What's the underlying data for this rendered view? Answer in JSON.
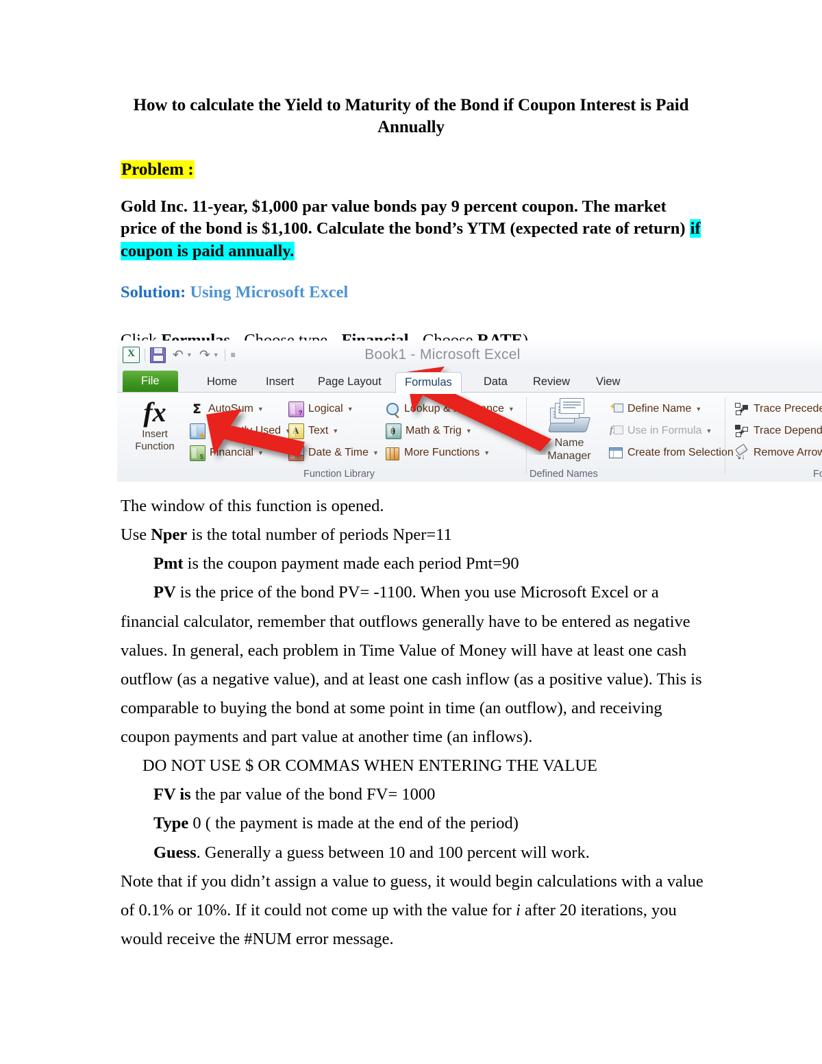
{
  "document": {
    "title_line1": "How to calculate the Yield to Maturity of the Bond if Coupon Interest is Paid",
    "title_line2": "Annually",
    "problem_label": "Problem :",
    "problem_text_part1": "Gold Inc. 11-year, $1,000 par value bonds pay 9 percent coupon. The market price of the bond is $1,100. Calculate the bond’s YTM (expected rate of return)",
    "problem_text_highlight": "if coupon is paid annually.",
    "solution_label": "Solution:",
    "solution_rest": "Using Microsoft Excel",
    "click_instruction": {
      "prefix": "Click ",
      "bold1": "Formulas - ",
      "mid1": " Choose type - ",
      "bold2": " Financial - ",
      "mid2": " Choose ",
      "bold3": "RATE",
      "suffix": ")"
    },
    "paragraphs": {
      "window_opened": "The window of this function is opened.",
      "nper_prefix": "Use  ",
      "nper_bold": "Nper",
      "nper_rest": " is the total number of periods Nper=11",
      "pmt_bold": "Pmt",
      "pmt_rest": " is the coupon payment made each period Pmt=90",
      "pv_bold": "PV",
      "pv_rest": " is the price of the bond PV= -1100.   When you use Microsoft Excel or a",
      "long_para": "financial calculator, remember that outflows generally have to be entered as negative values. In general, each problem in Time Value of Money will have at least one cash outflow (as a negative value), and at least one cash inflow (as a positive value). This is comparable to buying the bond at some point in time (an outflow), and receiving coupon payments and part value at another time (an inflows).",
      "do_not_use": "DO NOT USE $ OR COMMAS WHEN ENTERING THE VALUE",
      "fv_bold": "FV is",
      "fv_rest": " the par value of the bond FV= 1000",
      "type_bold": "Type",
      "type_rest": " 0 ( the payment is made at the end of the period)",
      "guess_bold": "Guess",
      "guess_rest": ". Generally a guess between 10 and 100 percent will work.",
      "note_part1": "Note that if you didn’t assign a value to guess, it would begin calculations with a value of 0.1% or 10%. If it could not come up with the value for ",
      "note_italic": "i",
      "note_part2": " after 20 iterations, you would receive the #NUM error message."
    }
  },
  "excel": {
    "window_title": "Book1  -  Microsoft Excel",
    "quick_access": {
      "logo": "excel-logo-icon",
      "save": "save-icon",
      "undo": "undo-icon",
      "redo": "redo-icon",
      "customize": "customize-qat-icon"
    },
    "tabs": [
      {
        "label": "File",
        "active": false,
        "is_file": true
      },
      {
        "label": "Home",
        "active": false
      },
      {
        "label": "Insert",
        "active": false
      },
      {
        "label": "Page Layout",
        "active": false
      },
      {
        "label": "Formulas",
        "active": true
      },
      {
        "label": "Data",
        "active": false
      },
      {
        "label": "Review",
        "active": false
      },
      {
        "label": "View",
        "active": false
      }
    ],
    "groups": {
      "function_library": {
        "title": "Function Library",
        "insert_function": {
          "label_line1": "Insert",
          "label_line2": "Function",
          "glyph": "fx"
        },
        "items": [
          {
            "label": "AutoSum",
            "dropdown": true
          },
          {
            "label": "Recently Used",
            "dropdown": true
          },
          {
            "label": "Financial",
            "dropdown": true
          },
          {
            "label": "Logical",
            "dropdown": true
          },
          {
            "label": "Text",
            "dropdown": true
          },
          {
            "label": "Date & Time",
            "dropdown": true
          },
          {
            "label": "Lookup & Reference",
            "dropdown": true
          },
          {
            "label": "Math & Trig",
            "dropdown": true
          },
          {
            "label": "More Functions",
            "dropdown": true
          }
        ]
      },
      "defined_names": {
        "title": "Defined Names",
        "name_manager": {
          "label_line1": "Name",
          "label_line2": "Manager"
        },
        "items": [
          {
            "label": "Define Name",
            "dropdown": true,
            "disabled": false
          },
          {
            "label": "Use in Formula",
            "dropdown": true,
            "disabled": true
          },
          {
            "label": "Create from Selection",
            "dropdown": false,
            "disabled": false
          }
        ]
      },
      "formula_auditing": {
        "title": "Formu",
        "items": [
          {
            "label": "Trace Precede"
          },
          {
            "label": "Trace Depend"
          },
          {
            "label": "Remove Arrow"
          }
        ]
      }
    },
    "annotations": [
      {
        "name": "arrow-to-formulas-tab",
        "color": "#E8211A"
      },
      {
        "name": "arrow-to-financial-button",
        "color": "#E8211A"
      }
    ]
  },
  "colors": {
    "highlight_yellow": "#FFFF00",
    "highlight_cyan": "#00FFFF",
    "solution_blue": "#1F6FC4",
    "solution_blue_light": "#4E93D2",
    "arrow_red": "#E8211A",
    "excel_green": "#3F9722"
  }
}
